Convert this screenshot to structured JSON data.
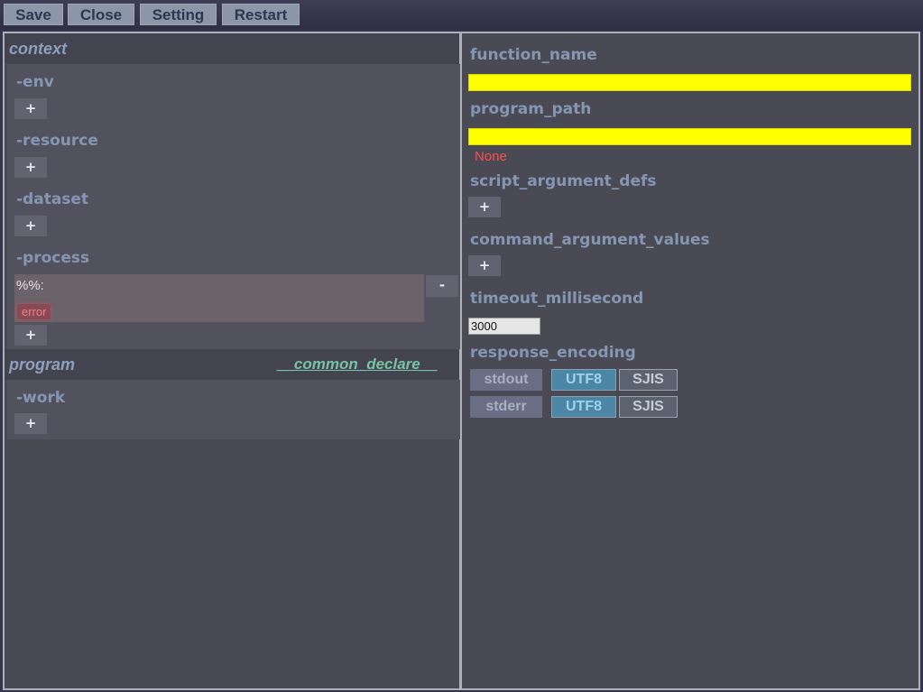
{
  "toolbar": {
    "save": "Save",
    "close": "Close",
    "setting": "Setting",
    "restart": "Restart"
  },
  "left": {
    "context_title": "context",
    "env_label": "-env",
    "resource_label": "-resource",
    "dataset_label": "-dataset",
    "process_label": "-process",
    "process_item_text": "%%:",
    "process_item_error": "error",
    "program_title": "program",
    "common_declare_link": "__common_declare__",
    "work_label": "-work",
    "plus": "+",
    "minus": "-"
  },
  "right": {
    "function_name_label": "function_name",
    "function_name_value": "",
    "program_path_label": "program_path",
    "program_path_value": "",
    "program_path_error": "None",
    "script_argument_defs_label": "script_argument_defs",
    "command_argument_values_label": "command_argument_values",
    "timeout_label": "timeout_millisecond",
    "timeout_value": "3000",
    "response_encoding_label": "response_encoding",
    "stdout_label": "stdout",
    "stderr_label": "stderr",
    "utf8": "UTF8",
    "sjis": "SJIS",
    "plus": "+"
  },
  "colors": {
    "highlight_input": "#ffff00",
    "error_text": "#ff4d4d",
    "active_encoding": "#4b86a4",
    "link": "#77c3a3"
  }
}
